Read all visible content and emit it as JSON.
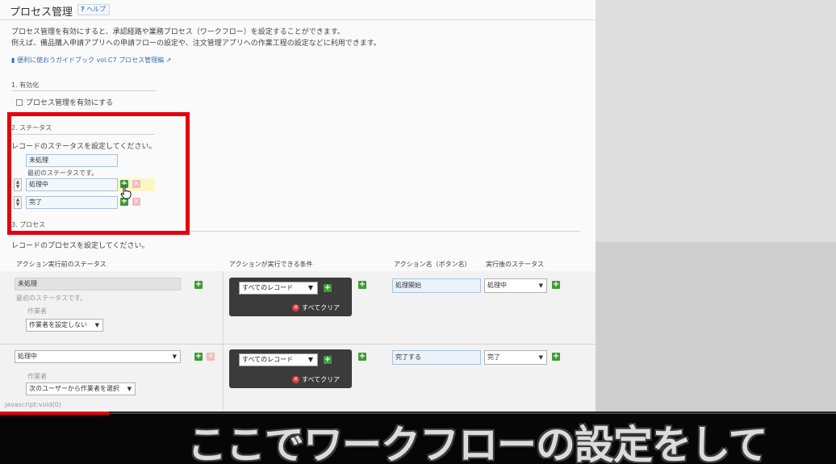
{
  "page": {
    "title": "プロセス管理",
    "help_icon": "?",
    "help_label": "ヘルプ",
    "desc_line1": "プロセス管理を有効にすると、承認経路や業務プロセス（ワークフロー）を設定することができます。",
    "desc_line2": "例えば、備品購入申請アプリへの申請フローの設定や、注文管理アプリへの作業工程の設定などに利用できます。",
    "guide_link": "便利に使おうガイドブック vol.C7 プロセス管理編"
  },
  "section1": {
    "heading": "1. 有効化",
    "checkbox_label": "プロセス管理を有効にする"
  },
  "section2": {
    "heading": "2. ステータス",
    "instruction": "レコードのステータスを設定してください。",
    "statuses": [
      "未処理",
      "処理中",
      "完了"
    ],
    "first_status_note": "最初のステータスです。"
  },
  "section3": {
    "heading": "3. プロセス",
    "instruction": "レコードのプロセスを設定してください。",
    "columns": [
      "アクション実行前のステータス",
      "アクションが実行できる条件",
      "アクション名（ボタン名）",
      "実行後のステータス"
    ],
    "rows": [
      {
        "before_status": "未処理",
        "note": "最初のステータスです。",
        "assignee_label": "作業者",
        "assignee_value": "作業者を設定しない",
        "condition": "すべてのレコード",
        "clear_label": "すべてクリア",
        "action_name": "処理開始",
        "after_status": "処理中"
      },
      {
        "before_status": "処理中",
        "assignee_label": "作業者",
        "assignee_value": "次のユーザーから作業者を選択",
        "condition": "すべてのレコード",
        "clear_label": "すべてクリア",
        "action_name": "完了する",
        "after_status": "完了"
      }
    ]
  },
  "browser_status": "javascript:void(0)",
  "video": {
    "subtitle": "ここでワークフローの設定をして",
    "progress_fraction": 0.13
  },
  "icons": {
    "add": "plus-icon",
    "delete": "x-icon",
    "reorder": "reorder-arrows-icon",
    "external": "external-link-icon",
    "guide": "book-icon",
    "cursor": "hand-pointer-icon"
  },
  "colors": {
    "accent_red": "#e3000f",
    "add_green": "#3d9b35",
    "link_blue": "#3a6fb0"
  }
}
